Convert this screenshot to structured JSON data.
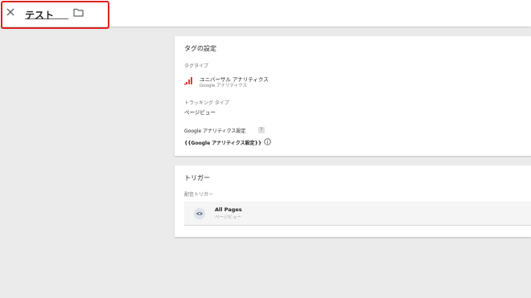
{
  "header": {
    "title": "テスト",
    "close_icon": "close-icon",
    "folder_icon": "folder-icon",
    "highlight_color": "#e0201b"
  },
  "tag_settings": {
    "heading": "タグの設定",
    "tag_type_label": "タグタイプ",
    "tag_type_name": "ユニバーサル アナリティクス",
    "tag_type_sub": "Google アナリティクス",
    "tracking_type_label": "トラッキング タイプ",
    "tracking_type_value": "ページビュー",
    "ga_settings_label": "Google アナリティクス設定",
    "help_badge": "?",
    "ga_settings_value": "{{Google アナリティクス設定}}"
  },
  "triggers": {
    "heading": "トリガー",
    "firing_label": "配信トリガー",
    "items": [
      {
        "name": "All Pages",
        "type": "ページビュー"
      }
    ]
  }
}
